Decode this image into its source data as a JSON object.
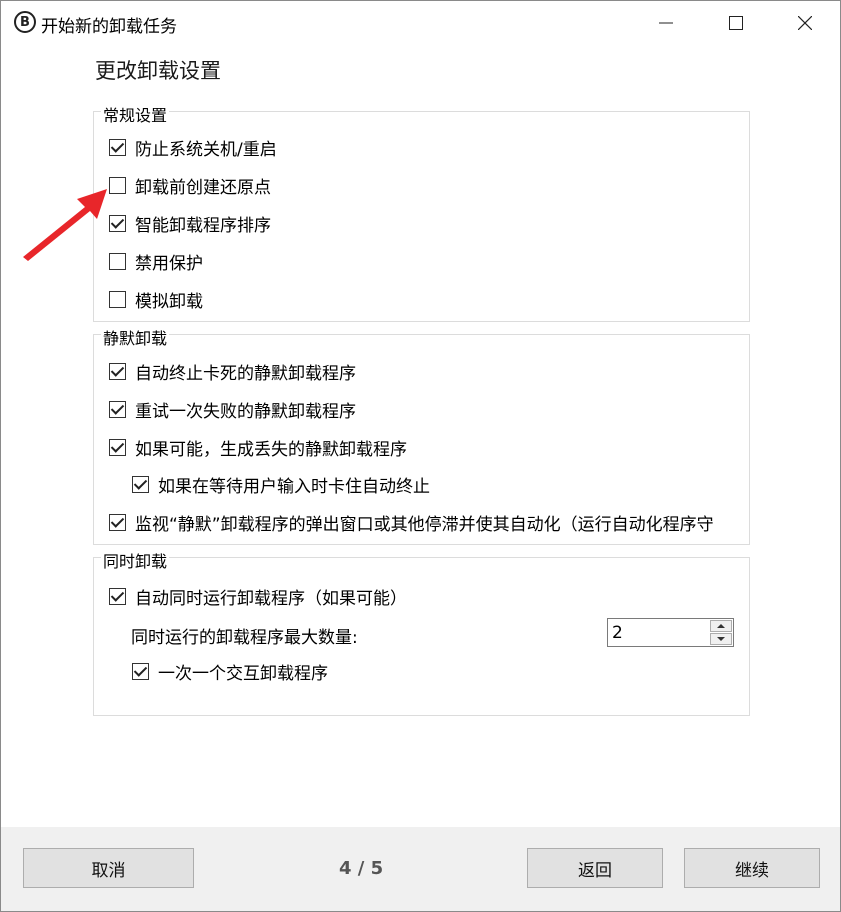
{
  "window": {
    "title": "开始新的卸载任务",
    "app_icon": "B"
  },
  "heading": "更改卸载设置",
  "groups": {
    "general": {
      "legend": "常规设置",
      "items": [
        {
          "label": "防止系统关机/重启",
          "checked": true
        },
        {
          "label": "卸载前创建还原点",
          "checked": false
        },
        {
          "label": "智能卸载程序排序",
          "checked": true
        },
        {
          "label": "禁用保护",
          "checked": false
        },
        {
          "label": "模拟卸载",
          "checked": false
        }
      ]
    },
    "silent": {
      "legend": "静默卸载",
      "items": [
        {
          "label": "自动终止卡死的静默卸载程序",
          "checked": true
        },
        {
          "label": "重试一次失败的静默卸载程序",
          "checked": true
        },
        {
          "label": "如果可能，生成丢失的静默卸载程序",
          "checked": true
        },
        {
          "label": "如果在等待用户输入时卡住自动终止",
          "checked": true
        },
        {
          "label": "监视“静默”卸载程序的弹出窗口或其他停滞并使其自动化（运行自动化程序守",
          "checked": true
        }
      ]
    },
    "concurrent": {
      "legend": "同时卸载",
      "auto_label": "自动同时运行卸载程序（如果可能）",
      "auto_checked": true,
      "max_label": "同时运行的卸载程序最大数量:",
      "max_value": "2",
      "one_interactive_label": "一次一个交互卸载程序",
      "one_interactive_checked": true
    }
  },
  "footer": {
    "cancel": "取消",
    "page": "4 / 5",
    "back": "返回",
    "next": "继续"
  },
  "colors": {
    "arrow": "#e8262a",
    "footer_bg": "#f0f0f0",
    "button_bg": "#e1e1e1"
  }
}
